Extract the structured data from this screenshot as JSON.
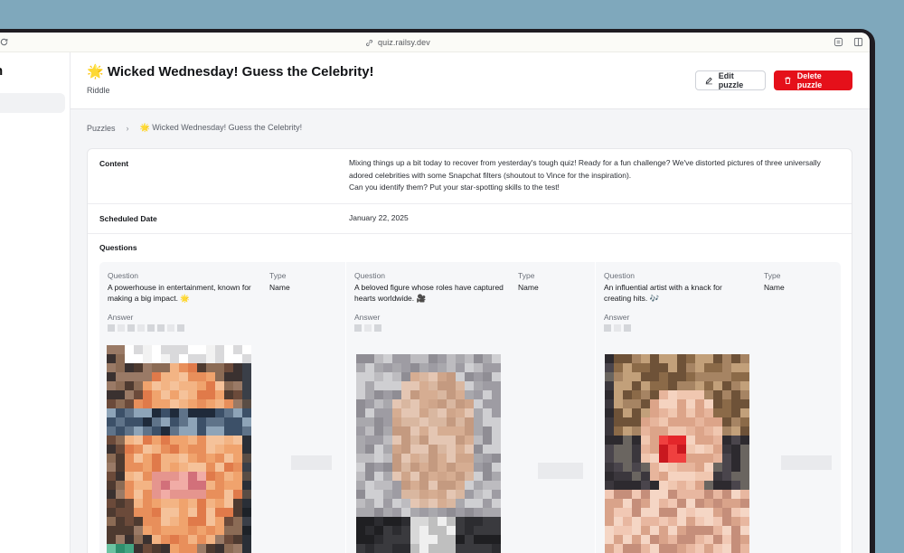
{
  "browser": {
    "url": "quiz.railsy.dev"
  },
  "sidebar": {
    "title_fragment": "n"
  },
  "header": {
    "title_emoji": "🌟",
    "title": "Wicked Wednesday! Guess the Celebrity!",
    "subtitle": "Riddle",
    "edit_label": "Edit puzzle",
    "delete_label": "Delete puzzle"
  },
  "breadcrumb": {
    "root": "Puzzles",
    "current": "🌟 Wicked Wednesday! Guess the Celebrity!"
  },
  "details": {
    "content_label": "Content",
    "content_lines": [
      "Mixing things up a bit today to recover from yesterday's tough quiz! Ready for a fun challenge? We've distorted pictures of three universally",
      "adored celebrities with some Snapchat filters (shoutout to Vince for the inspiration).",
      "Can you identify them? Put your star-spotting skills to the test!"
    ],
    "scheduled_label": "Scheduled Date",
    "scheduled_value": "January 22, 2025",
    "questions_label": "Questions"
  },
  "questions": [
    {
      "question_label": "Question",
      "question_lines": [
        "A powerhouse in entertainment, known for",
        "making a big impact. 🌟"
      ],
      "type_label": "Type",
      "type_value": "Name",
      "answer_label": "Answer"
    },
    {
      "question_label": "Question",
      "question_lines": [
        "A beloved figure whose roles have captured",
        "hearts worldwide. 🎥"
      ],
      "type_label": "Type",
      "type_value": "Name",
      "answer_label": "Answer"
    },
    {
      "question_label": "Question",
      "question_lines": [
        "An influential artist with a knack for",
        "creating hits. 🎶"
      ],
      "type_label": "Type",
      "type_value": "Name",
      "answer_label": "Answer"
    }
  ],
  "colors": {
    "accent_danger": "#e5101a",
    "frame": "#1f1c22",
    "backdrop": "#7fa8bc"
  },
  "icons": [
    "reload-icon",
    "link-icon",
    "share-icon",
    "sidebar-toggle-icon",
    "pencil-icon",
    "trash-icon",
    "chevron-right-icon"
  ]
}
